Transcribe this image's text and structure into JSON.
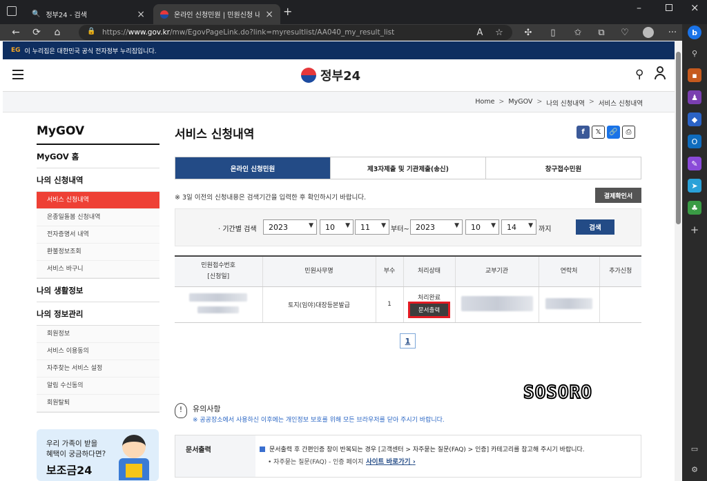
{
  "browser": {
    "tabs": [
      {
        "title": "정부24 - 검색",
        "icon": "search-icon"
      },
      {
        "title": "온라인 신청민원 | 민원신청 내역",
        "icon": "gov24-logo-icon"
      }
    ],
    "url_prefix": "https://",
    "url_domain": "www.gov.kr",
    "url_path": "/mw/EgovPageLink.do?link=myresultlist/AA040_my_result_list"
  },
  "gov_banner": {
    "mark": "EG",
    "text": "이 누리집은 대한민국 공식 전자정부 누리집입니다."
  },
  "header": {
    "logo_text": "정부24"
  },
  "breadcrumb": [
    "Home",
    "MyGOV",
    "나의 신청내역",
    "서비스 신청내역"
  ],
  "sidebar": {
    "title": "MyGOV",
    "sections": [
      {
        "label": "MyGOV 홈",
        "items": []
      },
      {
        "label": "나의 신청내역",
        "items": [
          "서비스 신청내역",
          "온종일돌봄 신청내역",
          "전자증명서 내역",
          "환불정보조회",
          "서비스 바구니"
        ]
      },
      {
        "label": "나의 생활정보",
        "items": []
      },
      {
        "label": "나의 정보관리",
        "items": [
          "회원정보",
          "서비스 이용동의",
          "자주찾는 서비스 설정",
          "알림 수신동의",
          "회원탈퇴"
        ]
      }
    ],
    "promo": {
      "line1": "우리 가족이 받을",
      "line2": "혜택이 궁금하다면?",
      "big": "보조금24"
    }
  },
  "main": {
    "title": "서비스 신청내역",
    "tabs": [
      "온라인 신청민원",
      "제3자제출 및 기관제출(송신)",
      "창구접수민원"
    ],
    "notice": "※ 3일 이전의 신청내용은 검색기간을 입력한 후 확인하시기 바랍니다.",
    "confirm_button": "결제확인서",
    "search": {
      "label": "· 기간별 검색",
      "from_year": "2023",
      "from_month": "10",
      "from_day": "11",
      "from_suffix": "부터~",
      "to_year": "2023",
      "to_month": "10",
      "to_day": "14",
      "to_suffix": "까지",
      "button": "검색"
    },
    "table": {
      "headers": [
        "민원접수번호\n[신청일]",
        "민원사무명",
        "부수",
        "처리상태",
        "교부기관",
        "연락처",
        "추가신청"
      ],
      "row": {
        "service": "토지(임야)대장등본발급",
        "copies": "1",
        "status": "처리완료",
        "print_button": "문서출력"
      }
    },
    "page": "1",
    "watermark": "SOSORO",
    "caution": {
      "title": "유의사항",
      "text": "※ 공공장소에서 사용하신 이후에는 개인정보 보호를 위해 모든 브라우저를 닫아 주시기 바랍니다."
    },
    "info": {
      "head": "문서출력",
      "line1": "문서출력 후 간편인증 창이 반복되는 경우 [고객센터 > 자주묻는 질문(FAQ) > 인증] 카테고리를 참고해 주시기 바랍니다.",
      "line2": "• 자주묻는 질문(FAQ) - 인증 페이지",
      "link": "사이트 바로가기"
    }
  },
  "colors": {
    "navy": "#234b86",
    "banner": "#0e2e60",
    "active_red": "#ee4035",
    "highlight": "#e31b23"
  }
}
